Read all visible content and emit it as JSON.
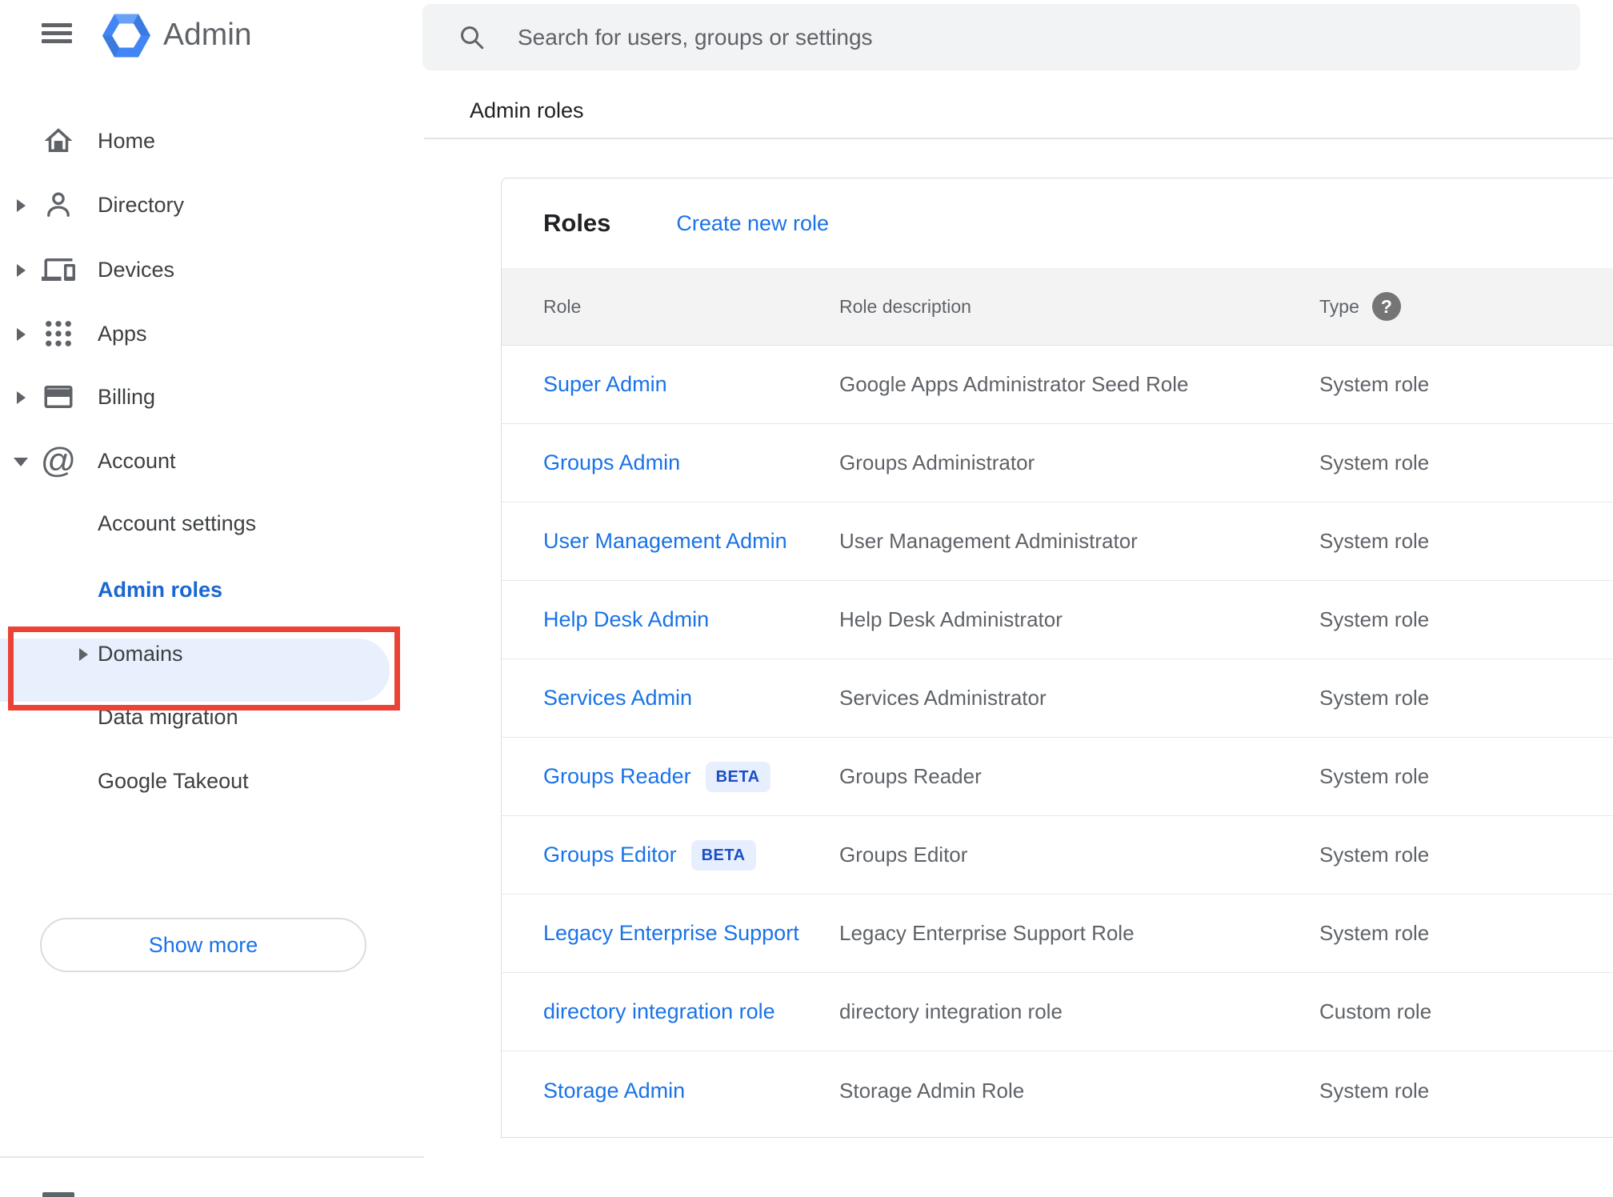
{
  "app": {
    "title": "Admin"
  },
  "search": {
    "placeholder": "Search for users, groups or settings"
  },
  "breadcrumb": "Admin roles",
  "sidebar": {
    "items": [
      {
        "label": "Home"
      },
      {
        "label": "Directory"
      },
      {
        "label": "Devices"
      },
      {
        "label": "Apps"
      },
      {
        "label": "Billing"
      },
      {
        "label": "Account"
      }
    ],
    "account_children": [
      {
        "label": "Account settings"
      },
      {
        "label": "Admin roles",
        "selected": true
      },
      {
        "label": "Domains"
      },
      {
        "label": "Data migration"
      },
      {
        "label": "Google Takeout"
      }
    ],
    "show_more_label": "Show more"
  },
  "panel": {
    "title": "Roles",
    "create_link": "Create new role",
    "columns": [
      "Role",
      "Role description",
      "Type"
    ],
    "help_glyph": "?",
    "rows": [
      {
        "role": "Super Admin",
        "description": "Google Apps Administrator Seed Role",
        "type": "System role"
      },
      {
        "role": "Groups Admin",
        "description": "Groups Administrator",
        "type": "System role"
      },
      {
        "role": "User Management Admin",
        "description": "User Management Administrator",
        "type": "System role"
      },
      {
        "role": "Help Desk Admin",
        "description": "Help Desk Administrator",
        "type": "System role"
      },
      {
        "role": "Services Admin",
        "description": "Services Administrator",
        "type": "System role"
      },
      {
        "role": "Groups Reader",
        "badge": "BETA",
        "description": "Groups Reader",
        "type": "System role"
      },
      {
        "role": "Groups Editor",
        "badge": "BETA",
        "description": "Groups Editor",
        "type": "System role"
      },
      {
        "role": "Legacy Enterprise Support",
        "description": "Legacy Enterprise Support Role",
        "type": "System role"
      },
      {
        "role": "directory integration role",
        "description": "directory integration role",
        "type": "Custom role"
      },
      {
        "role": "Storage Admin",
        "description": "Storage Admin Role",
        "type": "System role"
      }
    ]
  },
  "colors": {
    "link_blue": "#1a73e8",
    "selected_blue": "#1967d2",
    "selected_pill_bg": "#e8f0fe",
    "annotation_red": "#ea4335",
    "header_band": "#f3f3f3",
    "text_gray": "#5f6368",
    "text_dark": "#202124",
    "badge_bg": "#e7eefd",
    "badge_text": "#1b4fc4"
  }
}
